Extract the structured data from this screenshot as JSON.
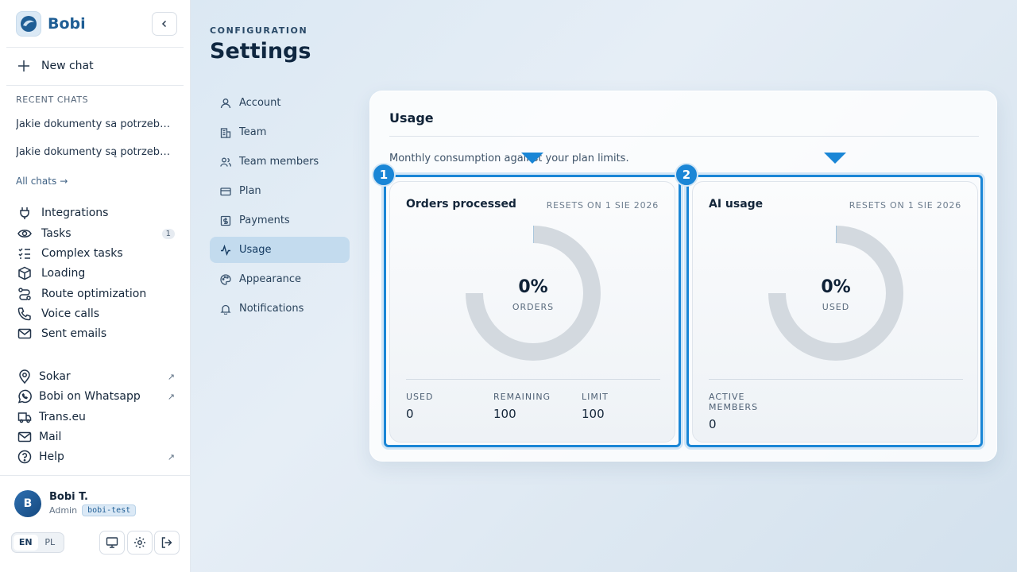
{
  "brand": {
    "name": "Bobi"
  },
  "sidebar": {
    "new_chat": "New chat",
    "recent_label": "RECENT CHATS",
    "recent_chats": [
      "Jakie dokumenty sa potrzebne do przewozu",
      "Jakie dokumenty są potrzebne do przewozu"
    ],
    "all_chats": "All chats",
    "items": [
      {
        "label": "Integrations",
        "icon": "plug-icon"
      },
      {
        "label": "Tasks",
        "icon": "eye-icon",
        "badge": "1"
      },
      {
        "label": "Complex tasks",
        "icon": "checklist-icon"
      },
      {
        "label": "Loading",
        "icon": "box-icon"
      },
      {
        "label": "Route optimization",
        "icon": "route-icon"
      },
      {
        "label": "Voice calls",
        "icon": "phone-icon"
      },
      {
        "label": "Sent emails",
        "icon": "mail-icon"
      }
    ],
    "external": [
      {
        "label": "Sokar",
        "icon": "map-pin-icon",
        "external": true
      },
      {
        "label": "Bobi on Whatsapp",
        "icon": "whatsapp-icon",
        "external": true
      },
      {
        "label": "Trans.eu",
        "icon": "truck-icon",
        "external": false
      },
      {
        "label": "Mail",
        "icon": "mail-icon",
        "external": false
      },
      {
        "label": "Help",
        "icon": "help-icon",
        "external": true
      }
    ],
    "user": {
      "initial": "B",
      "name": "Bobi T.",
      "role": "Admin",
      "tag": "bobi-test"
    },
    "languages": [
      "EN",
      "PL"
    ],
    "active_language": "EN"
  },
  "header": {
    "eyebrow": "CONFIGURATION",
    "title": "Settings"
  },
  "settings_nav": [
    {
      "label": "Account",
      "icon": "user-icon",
      "active": false
    },
    {
      "label": "Team",
      "icon": "building-icon",
      "active": false
    },
    {
      "label": "Team members",
      "icon": "users-icon",
      "active": false
    },
    {
      "label": "Plan",
      "icon": "card-icon",
      "active": false
    },
    {
      "label": "Payments",
      "icon": "dollar-icon",
      "active": false
    },
    {
      "label": "Usage",
      "icon": "activity-icon",
      "active": true
    },
    {
      "label": "Appearance",
      "icon": "palette-icon",
      "active": false
    },
    {
      "label": "Notifications",
      "icon": "bell-icon",
      "active": false
    }
  ],
  "usage": {
    "title": "Usage",
    "subtitle": "Monthly consumption against your plan limits.",
    "cards": [
      {
        "title": "Orders processed",
        "reset": "RESETS ON 1 SIE 2026",
        "percent_text": "0%",
        "percent": 0,
        "unit": "ORDERS",
        "stats": [
          {
            "label": "USED",
            "value": "0"
          },
          {
            "label": "REMAINING",
            "value": "100"
          },
          {
            "label": "LIMIT",
            "value": "100"
          }
        ]
      },
      {
        "title": "AI usage",
        "reset": "RESETS ON 1 SIE 2026",
        "percent_text": "0%",
        "percent": 0,
        "unit": "USED",
        "stats": [
          {
            "label": "ACTIVE MEMBERS",
            "value": "0"
          }
        ]
      }
    ]
  },
  "annotations": {
    "markers": [
      "1",
      "2"
    ]
  },
  "colors": {
    "accent": "#1a86d6",
    "brand": "#1f5e95",
    "active_nav": "#c3dbee",
    "track": "#d3d9df"
  }
}
